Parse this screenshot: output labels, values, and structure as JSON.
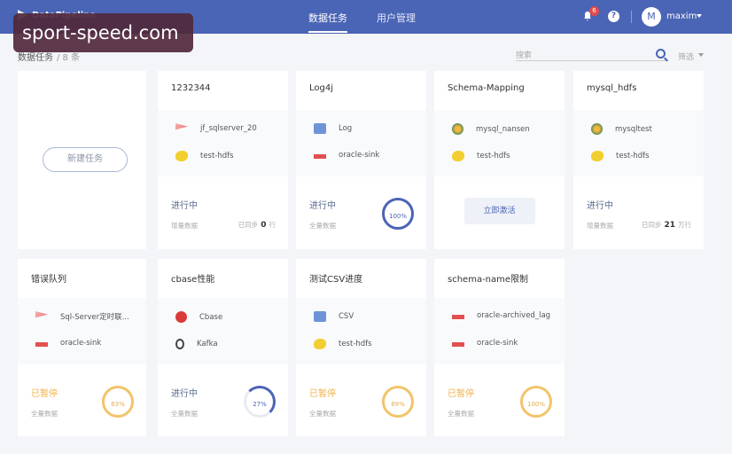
{
  "app": {
    "logo": "DataPipeline"
  },
  "nav": {
    "tabs": [
      {
        "label": "数据任务"
      },
      {
        "label": "用户管理"
      }
    ]
  },
  "header": {
    "bell_count": "6",
    "help": "?",
    "avatar_initial": "M",
    "username": "maxim"
  },
  "watermark": {
    "text": "sport-speed.com"
  },
  "page": {
    "breadcrumb": "数据任务",
    "count": "/ 8 条",
    "search_placeholder": "搜索",
    "filter_label": "筛选"
  },
  "new_task": {
    "label": "新建任务"
  },
  "cards": [
    {
      "title": "1232344",
      "source": "jf_sqlserver_20",
      "target": "test-hdfs",
      "status": "进行中",
      "mode": "增量数据",
      "synced_prefix": "已同步",
      "synced_value": "0",
      "synced_unit": "行"
    },
    {
      "title": "Log4j",
      "source": "Log",
      "target": "oracle-sink",
      "status": "进行中",
      "mode": "全量数据",
      "progress": "100%"
    },
    {
      "title": "Schema-Mapping",
      "source": "mysql_nansen",
      "target": "test-hdfs",
      "action": "立即激活"
    },
    {
      "title": "mysql_hdfs",
      "source": "mysqltest",
      "target": "test-hdfs",
      "status": "进行中",
      "mode": "增量数据",
      "synced_prefix": "已同步",
      "synced_value": "21",
      "synced_unit": "万行"
    },
    {
      "title": "错误队列",
      "source": "Sql-Server定时联...",
      "target": "oracle-sink",
      "status": "已暂停",
      "mode": "全量数据",
      "progress": "63%"
    },
    {
      "title": "cbase性能",
      "source": "Cbase",
      "target": "Kafka",
      "status": "进行中",
      "mode": "全量数据",
      "progress": "27%"
    },
    {
      "title": "测试CSV进度",
      "source": "CSV",
      "target": "test-hdfs",
      "status": "已暂停",
      "mode": "全量数据",
      "progress": "89%"
    },
    {
      "title": "schema-name限制",
      "source": "oracle-archived_lag",
      "target": "oracle-sink",
      "status": "已暂停",
      "mode": "全量数据",
      "progress": "100%"
    }
  ]
}
